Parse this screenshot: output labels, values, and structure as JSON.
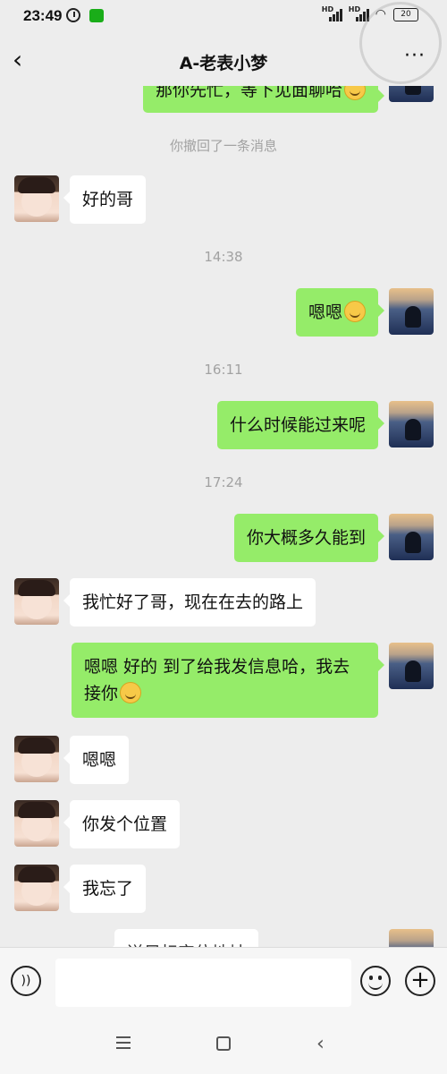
{
  "status_bar": {
    "time": "23:49",
    "battery": "20",
    "hd1": "HD",
    "hd2": "HD"
  },
  "header": {
    "title": "A-老表小梦"
  },
  "messages": {
    "m0": "那你先忙，等下见面聊哈",
    "recall": "你撤回了一条消息",
    "m1": "好的哥",
    "t1": "14:38",
    "m2": "嗯嗯",
    "t2": "16:11",
    "m3": "什么时候能过来呢",
    "t3": "17:24",
    "m4": "你大概多久能到",
    "m5": "我忙好了哥，现在在去的路上",
    "m6": "嗯嗯  好的  到了给我发信息哈，我去接你",
    "m7": "嗯嗯",
    "m8": "你发个位置",
    "m9": "我忘了",
    "m10": "送目标定位地址"
  },
  "colors": {
    "sent_bubble": "#95ec69",
    "received_bubble": "#ffffff",
    "background": "#ededed"
  }
}
